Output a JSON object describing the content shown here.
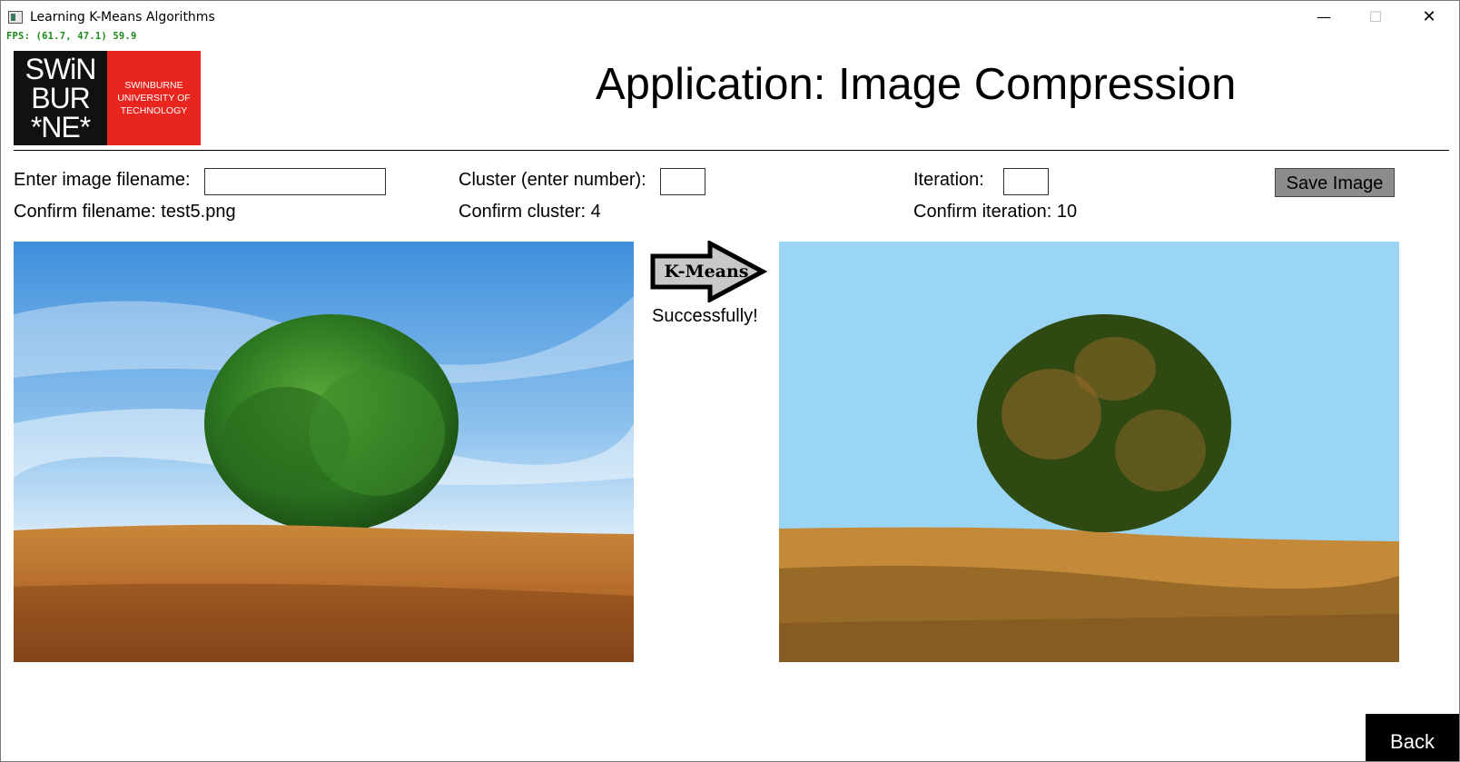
{
  "window": {
    "title": "Learning K-Means Algorithms",
    "minimize_glyph": "—",
    "maximize_glyph": "☐",
    "close_glyph": "✕"
  },
  "fps_readout": "FPS: (61.7, 47.1) 59.9",
  "logo": {
    "left_lines": [
      "SWiN",
      "BUR",
      "*NE*"
    ],
    "right_lines": [
      "SWINBURNE",
      "UNIVERSITY OF",
      "TECHNOLOGY"
    ]
  },
  "header": {
    "title": "Application: Image Compression"
  },
  "controls": {
    "filename_label": "Enter image filename:",
    "filename_value": "",
    "cluster_label": "Cluster (enter number):",
    "cluster_value": "",
    "iteration_label": "Iteration:",
    "iteration_value": "",
    "save_label": "Save Image",
    "confirm_filename": "Confirm filename: test5.png",
    "confirm_cluster": "Confirm cluster: 4",
    "confirm_iteration": "Confirm iteration: 10"
  },
  "arrow": {
    "label": "K-Means"
  },
  "status": {
    "message": "Successfully!"
  },
  "footer": {
    "back_label": "Back"
  },
  "colors": {
    "logo_red": "#e8261f",
    "compressed_sky": "#9ad5f5",
    "compressed_tree": "#2e4a12",
    "compressed_grass": "#c48a3a",
    "compressed_dark_grass": "#8a5f22",
    "fps_green": "#1a8a1a"
  }
}
